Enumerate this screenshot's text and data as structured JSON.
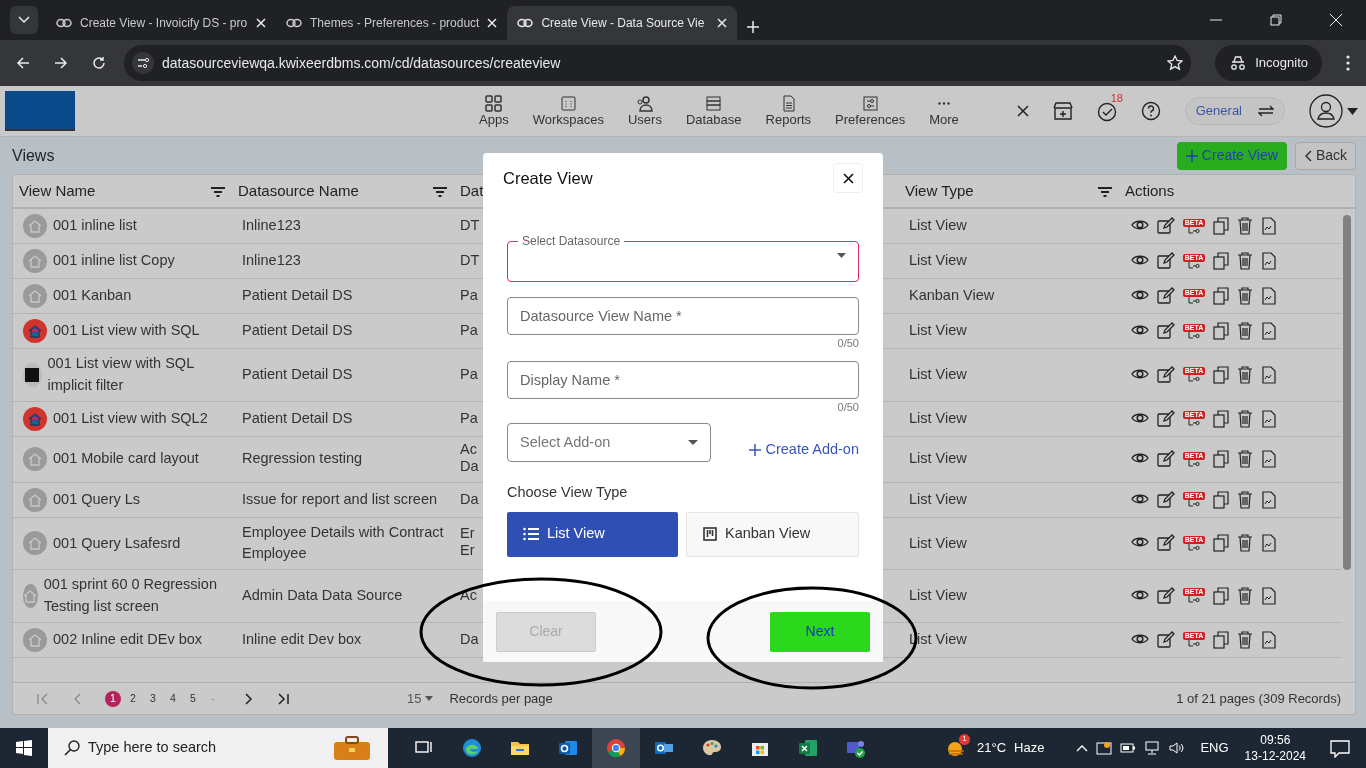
{
  "browser": {
    "tabs": [
      {
        "title": "Create View - Invoicify DS - pro",
        "selected": false
      },
      {
        "title": "Themes - Preferences - product",
        "selected": false
      },
      {
        "title": "Create View - Data Source Vie",
        "selected": true
      }
    ],
    "url": "datasourceviewqa.kwixeerdbms.com/cd/datasources/createview",
    "profile": "Incognito"
  },
  "app": {
    "nav": [
      {
        "label": "Apps"
      },
      {
        "label": "Workspaces"
      },
      {
        "label": "Users"
      },
      {
        "label": "Database"
      },
      {
        "label": "Reports"
      },
      {
        "label": "Preferences"
      },
      {
        "label": "More"
      }
    ],
    "task_count": "18",
    "workspace": "General"
  },
  "page": {
    "title": "Views",
    "create_button": "Create View",
    "back_button": "Back"
  },
  "table": {
    "columns": [
      {
        "label": "View Name",
        "filter": true
      },
      {
        "label": "Datasource Name",
        "filter": true
      },
      {
        "label": "Dat",
        "filter": false
      },
      {
        "label": "View Type",
        "filter": true
      },
      {
        "label": "Actions",
        "filter": false
      }
    ],
    "rows": [
      {
        "kind": "home",
        "view_name": "001 inline list",
        "datasource": "Inline123",
        "column_3": "DT",
        "view_type": "List View",
        "beta": "BETA"
      },
      {
        "kind": "home",
        "view_name": "001 inline list Copy",
        "datasource": "Inline123",
        "column_3": "DT",
        "view_type": "List View",
        "beta": "BETA"
      },
      {
        "kind": "home",
        "view_name": "001 Kanban",
        "datasource": "Patient Detail DS",
        "column_3": "Pa",
        "view_type": "Kanban View",
        "beta": "BETA"
      },
      {
        "kind": "red",
        "view_name": "001 List view with SQL",
        "datasource": "Patient Detail DS",
        "column_3": "Pa",
        "view_type": "List View",
        "beta": "BETA"
      },
      {
        "kind": "photo",
        "view_name": "001 List view with SQL implicit filter",
        "datasource": "Patient Detail DS",
        "column_3": "Pa",
        "view_type": "List View",
        "beta": "BETA"
      },
      {
        "kind": "red",
        "view_name": "001 List view with SQL2",
        "datasource": "Patient Detail DS",
        "column_3": "Pa",
        "view_type": "List View",
        "beta": "BETA"
      },
      {
        "kind": "home",
        "view_name": "001 Mobile card layout",
        "datasource": "Regression testing",
        "column_3": "Ac Da",
        "view_type": "List View",
        "beta": "BETA"
      },
      {
        "kind": "home",
        "view_name": "001 Query Ls",
        "datasource": "Issue for report and list screen",
        "column_3": "Da",
        "view_type": "List View",
        "beta": "BETA"
      },
      {
        "kind": "home",
        "view_name": "001 Query Lsafesrd",
        "datasource": "Employee Details with Contract Employee",
        "column_3": "Er Er",
        "view_type": "List View",
        "beta": "BETA"
      },
      {
        "kind": "home",
        "view_name": "001 sprint 60 0 Regression Testing list screen",
        "datasource": "Admin Data Data Source",
        "column_3": "Ac",
        "view_type": "List View",
        "beta": "BETA"
      },
      {
        "kind": "home",
        "view_name": "002 Inline edit DEv box",
        "datasource": "Inline edit Dev box",
        "column_3": "Da",
        "view_type": "List View",
        "beta": "BETA"
      }
    ]
  },
  "pagination": {
    "pages": [
      {
        "label": "1",
        "selected": true
      },
      {
        "label": "2",
        "selected": false
      },
      {
        "label": "3",
        "selected": false
      },
      {
        "label": "4",
        "selected": false
      },
      {
        "label": "5",
        "selected": false
      }
    ],
    "ellipsis": "-",
    "page_size": "15",
    "page_size_label": "Records per page",
    "summary": "1 of 21 pages (309 Records)"
  },
  "modal": {
    "title": "Create View",
    "datasource_label": "Select Datasource",
    "datasource_invalid": true,
    "view_name_placeholder": "Datasource View Name *",
    "view_name_counter": "0/50",
    "display_name_placeholder": "Display Name *",
    "display_name_counter": "0/50",
    "addon_placeholder": "Select Add-on",
    "create_addon": "Create Add-on",
    "view_type_label": "Choose View Type",
    "view_types": [
      {
        "kind": "list",
        "label": "List View",
        "selected": true
      },
      {
        "kind": "kanban",
        "label": "Kanban View",
        "selected": false
      }
    ],
    "clear_button": {
      "label": "Clear",
      "disabled": true
    },
    "next_button": {
      "label": "Next",
      "disabled": false
    }
  },
  "taskbar": {
    "search_placeholder": "Type here to search",
    "weather": "21°C",
    "weather_text": "Haze",
    "weather_badge": "1",
    "language": "ENG",
    "time": "09:56",
    "date": "13-12-2024"
  }
}
